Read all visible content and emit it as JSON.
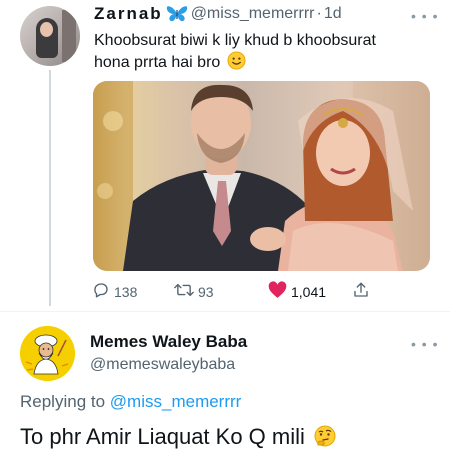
{
  "tweet": {
    "author_name": "Zarnab",
    "author_handle": "@miss_memerrrr",
    "separator": "·",
    "time": "1d",
    "text": "Khoobsurat biwi k liy khud b khoobsurat hona prrta hai bro",
    "stats": {
      "replies": "138",
      "retweets": "93",
      "likes": "1,041"
    },
    "like_color": "#e0245e"
  },
  "reply": {
    "author_name": "Memes Waley Baba",
    "author_handle": "@memeswaleybaba",
    "replying_prefix": "Replying to",
    "replying_to": "@miss_memerrrr",
    "text": "To phr Amir Liaquat Ko Q mili"
  },
  "icons": {
    "name_badge": "butterfly-icon",
    "text_emoji": "smiling-face-emoji",
    "reply_emoji": "thinking-face-emoji",
    "more": "more-dots-icon",
    "reply": "reply-bubble-icon",
    "retweet": "retweet-icon",
    "like": "heart-icon",
    "share": "share-icon"
  },
  "colors": {
    "link": "#1d9bf0",
    "secondary_text": "#536471",
    "avatar2_bg": "#f6cf00"
  }
}
